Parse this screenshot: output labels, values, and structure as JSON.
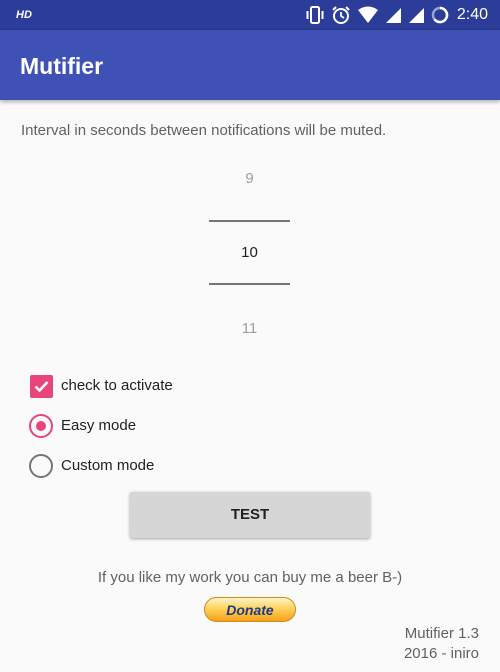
{
  "status_bar": {
    "hd_label": "HD",
    "time": "2:40",
    "icons": [
      "vibrate-icon",
      "alarm-icon",
      "wifi-icon",
      "signal-icon",
      "signal-icon",
      "battery-charging-icon"
    ]
  },
  "app_bar": {
    "title": "Mutifier"
  },
  "description": "Interval in seconds between notifications will be muted.",
  "number_picker": {
    "previous": "9",
    "current": "10",
    "next": "11"
  },
  "options": {
    "activate_label": "check to activate",
    "activate_checked": true,
    "easy_mode_label": "Easy mode",
    "custom_mode_label": "Custom mode",
    "selected_mode": "Easy mode"
  },
  "test_button_label": "TEST",
  "promo_text": "If you like my work you can buy me a beer B-)",
  "donate_label": "Donate",
  "version": {
    "name": "Mutifier 1.3",
    "year": "2016 - iniro"
  },
  "colors": {
    "status_bar": "#2c3c99",
    "app_bar": "#3f51b5",
    "accent": "#e8457a",
    "background": "#fafafa",
    "button": "#d6d6d6"
  }
}
